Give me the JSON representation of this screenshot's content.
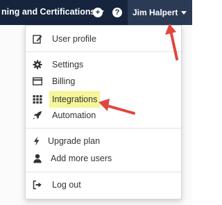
{
  "topbar": {
    "title": "ning and Certifications",
    "add_icon": "plus-circle-icon",
    "help_icon": "question-circle-icon",
    "user_name": "Jim Halpert"
  },
  "menu": {
    "user_profile": "User profile",
    "settings": "Settings",
    "billing": "Billing",
    "integrations": "Integrations",
    "automation": "Automation",
    "upgrade_plan": "Upgrade plan",
    "add_more_users": "Add more users",
    "log_out": "Log out"
  },
  "colors": {
    "topbar_bg": "#16243d",
    "user_tab_bg": "#2b3a55",
    "highlight": "#f6f59a",
    "annotation_arrow": "#e2453c"
  }
}
